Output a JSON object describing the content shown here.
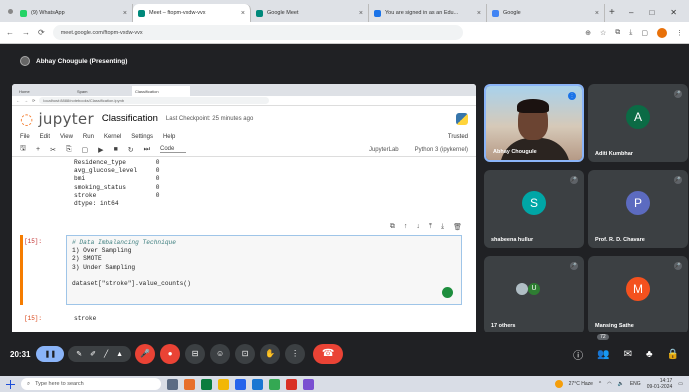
{
  "browser": {
    "tabs": [
      {
        "label": "(9) WhatsApp",
        "color": "#25d366",
        "active": false
      },
      {
        "label": "Meet – ftopm-vxdw-vvx",
        "color": "#00897b",
        "active": true
      },
      {
        "label": "Google Meet",
        "color": "#00897b",
        "active": false
      },
      {
        "label": "You are signed in as an Edu...",
        "color": "#1a73e8",
        "active": false
      },
      {
        "label": "Google",
        "color": "#4285f4",
        "active": false
      }
    ],
    "url": "meet.google.com/ftopm-vxdw-vvx",
    "accent": "#1a73e8"
  },
  "meet": {
    "presenter": "Abhay Chougule (Presenting)",
    "time": "20:31",
    "participant_count": "72",
    "participants": [
      {
        "name": "Abhay Chougule",
        "initial": "",
        "color": "",
        "type": "video"
      },
      {
        "name": "Aditi Kumbhar",
        "initial": "A",
        "color": "#0b6b45",
        "type": "avatar"
      },
      {
        "name": "shabeena hullur",
        "initial": "S",
        "color": "#00a6a6",
        "type": "avatar"
      },
      {
        "name": "Prof. R. D. Chavare",
        "initial": "P",
        "color": "#5c6bc0",
        "type": "avatar"
      },
      {
        "name": "17 others",
        "initial": "U",
        "color": "#2e7d32",
        "type": "others"
      },
      {
        "name": "Mansing Sathe",
        "initial": "M",
        "color": "#f4511e",
        "type": "avatar"
      }
    ]
  },
  "inner_browser": {
    "tabs": [
      "Home",
      "Spam",
      "Classification"
    ],
    "url": "localhost:8888/notebooks/Classification.ipynb"
  },
  "jupyter": {
    "logo": "jupyter",
    "notebook_name": "Classification",
    "checkpoint": "Last Checkpoint: 25 minutes ago",
    "menu": [
      "File",
      "Edit",
      "View",
      "Run",
      "Kernel",
      "Settings",
      "Help"
    ],
    "trusted": "Trusted",
    "cell_type": "Code",
    "jupyterlab": "JupyterLab",
    "kernel": "Python 3 (ipykernel)",
    "output1": "Residence_type        0\navg_glucose_level     0\nbmi                   0\nsmoking_status        0\nstroke                0\ndtype: int64",
    "cell_prompt": "[15]:",
    "cell_comment": "# Data Imbalancing Technique",
    "cell_code": "1) Over Sampling\n2) SMOTE\n3) Under Sampling\n\ndataset[\"stroke\"].value_counts()",
    "out_prompt": "[15]:",
    "output2": "stroke"
  },
  "taskbar": {
    "search_placeholder": "Type here to search",
    "weather": "27°C Haze",
    "time": "14:17",
    "date": "09-01-2024",
    "lang": "ENG"
  }
}
